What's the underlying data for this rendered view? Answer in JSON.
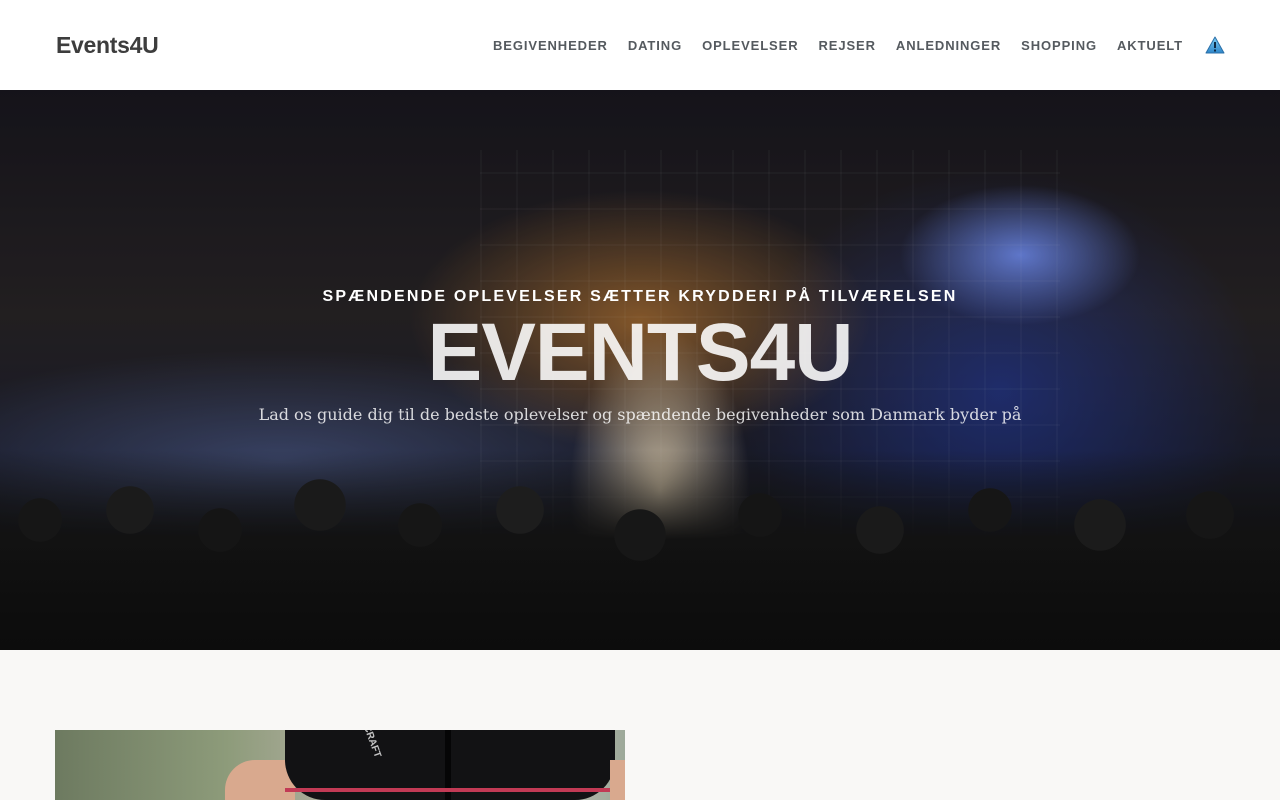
{
  "header": {
    "logo": "Events4U",
    "nav": [
      {
        "label": "BEGIVENHEDER"
      },
      {
        "label": "DATING"
      },
      {
        "label": "OPLEVELSER"
      },
      {
        "label": "REJSER"
      },
      {
        "label": "ANLEDNINGER"
      },
      {
        "label": "SHOPPING"
      },
      {
        "label": "AKTUELT"
      }
    ],
    "warning_icon": "warning-icon"
  },
  "hero": {
    "tagline": "SPÆNDENDE OPLEVELSER SÆTTER KRYDDERI PÅ TILVÆRELSEN",
    "title": "EVENTS4U",
    "subtitle": "Lad os guide dig til de bedste oplevelser og spændende begivenheder som Danmark byder på"
  },
  "content": {
    "image_brand": "CRAFT"
  },
  "colors": {
    "header_bg": "#ffffff",
    "nav_text": "#555a5f",
    "logo_text": "#3d3d3d",
    "page_bg": "#f9f8f6",
    "warning_icon": "#2e9bd6"
  }
}
